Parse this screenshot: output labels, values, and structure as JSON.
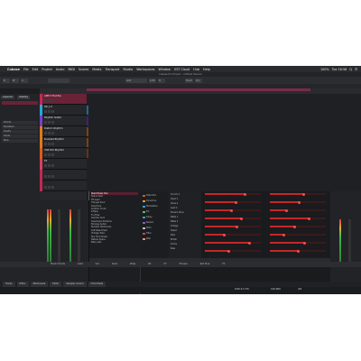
{
  "menubar": {
    "apple": "",
    "app": "Cubase",
    "items": [
      "File",
      "Edit",
      "Project",
      "Audio",
      "MIDI",
      "Scores",
      "Media",
      "Transport",
      "Studio",
      "Workspaces",
      "Window",
      "VST Cloud",
      "Hub",
      "Help"
    ],
    "right": [
      "100%",
      "Tue 16:58",
      "Q",
      "☰"
    ]
  },
  "window": {
    "title": "Cubase Pro Project - Untitled Session"
  },
  "toolbar": {
    "buttons": [
      "R",
      "W",
      "A",
      "Grid",
      "1/16",
      "Q",
      "Touch",
      "1/4"
    ]
  },
  "inspector": {
    "tabs": [
      "Inspector",
      "Visibility"
    ],
    "rows": [
      "Chords",
      "Equalizers",
      "Inserts",
      "Sends",
      "Strip"
    ]
  },
  "tracks": [
    {
      "name": "AMP 4 Fret Pre",
      "color": "#c02a55"
    },
    {
      "name": "Gtr_Ld",
      "color": "#2aa6d8"
    },
    {
      "name": "Rhythm Guitar",
      "color": "#7a3fc8"
    },
    {
      "name": "Distort. Rhythm",
      "color": "#e07a1a"
    },
    {
      "name": "Doubled Rhythm",
      "color": "#e07a1a"
    },
    {
      "name": "VOX DUI Rhythm",
      "color": "#e05a1a"
    },
    {
      "name": "FX",
      "color": "#d84060"
    },
    {
      "name": "",
      "color": "#c02a55"
    },
    {
      "name": "",
      "color": "#c02a55"
    }
  ],
  "plugin": {
    "title": "AMP 4 Fret Pre - Ins. 1 - VST Amp Rack",
    "preset_name": "Road Power Dox",
    "browser_header": "Presets",
    "presets": [
      "Dirty",
      "Modern",
      "Clean",
      "Blackface Pro",
      "Brit Bite",
      "Bell Tower Crush",
      "Bass Amp Pres",
      "Tone Mash",
      "Nothing Else",
      "Euphonia",
      "Doom Breath",
      "Twisted Smoke",
      "Gentle Nirvana",
      "Moodie Blues",
      "Marsh Jam",
      "Beeping",
      "Dirty Jam",
      "Tone Zap",
      "Trumpet",
      "Power Fap Lead",
      "Road Power Dox",
      "Space Gem",
      "Hit Lead",
      "Triangle Punk",
      "Overdrive",
      "Another Crush",
      "Z Bass",
      "Tru Flow",
      "Gremlin Gum",
      "Overblown Extreme",
      "Strange Guitar",
      "Stacked Harmonies",
      "Soft Weed Pearl",
      "Vintage Tube",
      "Sky Thrill Power",
      "Nebula Space",
      "Basic Jazz"
    ],
    "amp_preset": "Road Power Dox",
    "tabs": [
      "Amp",
      "Cab",
      "Pre",
      "Post",
      "Master"
    ],
    "modules": [
      {
        "name": "Noise",
        "color": "#7a7a7a"
      },
      {
        "name": "Distortion",
        "color": "#d05a2a"
      },
      {
        "name": "Dynamics",
        "color": "#e0a020"
      },
      {
        "name": "Modulation",
        "color": "#3a9ae0"
      },
      {
        "name": "EQ",
        "color": "#5ac060"
      },
      {
        "name": "Delay",
        "color": "#3aa0c0"
      },
      {
        "name": "Reverb",
        "color": "#8a5ad0"
      },
      {
        "name": "Pitch",
        "color": "#c0c0c0"
      },
      {
        "name": "Filter",
        "color": "#d04070"
      },
      {
        "name": "Wah",
        "color": "#d0a060"
      }
    ],
    "models": [
      "Crunch 3",
      "Crunch 4",
      "Clean 1",
      "Clean 2",
      "Lead 2",
      "Modern Drive",
      "Metal 1",
      "Metal 2",
      "Vintage",
      "Tweed",
      "Plexi",
      "British",
      "Chime",
      "Bass"
    ],
    "section_title": "Channel 1/2",
    "params": [
      {
        "name": "Gain",
        "value": 0.72
      },
      {
        "name": "Bass",
        "value": 0.55
      },
      {
        "name": "Middle",
        "value": 0.48
      },
      {
        "name": "Treble",
        "value": 0.65
      },
      {
        "name": "Presence",
        "value": 0.58
      },
      {
        "name": "Master",
        "value": 0.35
      },
      {
        "name": "Volume",
        "value": 0.8
      },
      {
        "name": "Drive",
        "value": 0.42
      },
      {
        "name": "Tone",
        "value": 0.6
      },
      {
        "name": "Level",
        "value": 0.52
      },
      {
        "name": "Mix",
        "value": 0.3
      },
      {
        "name": "Output",
        "value": 0.7
      },
      {
        "name": "Depth",
        "value": 0.44
      },
      {
        "name": "Rate",
        "value": 0.25
      },
      {
        "name": "Feedback",
        "value": 0.62
      },
      {
        "name": "Time",
        "value": 0.5
      }
    ]
  },
  "mixbar": {
    "items": [
      "Music Chords",
      "Lead",
      "Vox",
      "Send",
      "Wrap",
      "RC",
      "CT",
      "Process",
      "Sell Tone",
      "FX"
    ]
  },
  "lower_tabs": [
    "Tracks",
    "Editor",
    "MixConsole",
    "Editor",
    "Sampler Control",
    "Chord Pads"
  ],
  "transport": {
    "time": "0:00:11.715",
    "tempo": "120.000",
    "signature": "4/4"
  },
  "colors": {
    "accent": "#c02a55",
    "slider": "#c22828",
    "bg": "#1c1d20"
  }
}
